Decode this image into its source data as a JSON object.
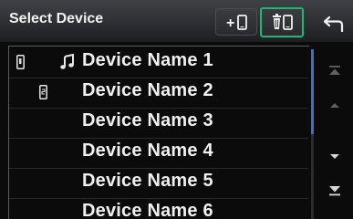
{
  "header": {
    "title": "Select Device",
    "add_button_icon": "add-phone-icon",
    "delete_button_icon": "delete-phone-icon",
    "back_button_icon": "back-arrow-icon"
  },
  "devices": [
    {
      "name": "Device Name 1",
      "phone_slot": "1",
      "audio_connected": true
    },
    {
      "name": "Device Name 2",
      "phone_slot": "2",
      "audio_connected": false
    },
    {
      "name": "Device Name 3",
      "phone_slot": "",
      "audio_connected": false
    },
    {
      "name": "Device Name 4",
      "phone_slot": "",
      "audio_connected": false
    },
    {
      "name": "Device Name 5",
      "phone_slot": "",
      "audio_connected": false
    },
    {
      "name": "Device Name 6",
      "phone_slot": "",
      "audio_connected": false
    }
  ],
  "scroll": {
    "buttons": [
      "scroll-top-icon",
      "page-up-icon",
      "page-down-icon",
      "scroll-bottom-icon"
    ],
    "thumb_fraction": 0.5
  },
  "colors": {
    "accent_border": "#1fb774",
    "scroll_thumb": "#3d6fc6",
    "text": "#f0f0f0",
    "header_bg": "#34363a"
  }
}
